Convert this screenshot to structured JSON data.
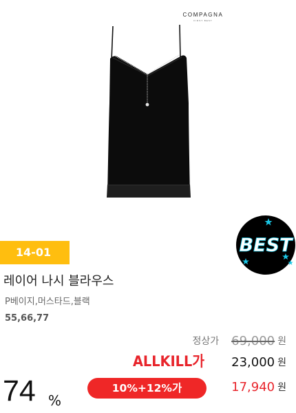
{
  "brand": {
    "name": "COMPAGNA",
    "tagline": "FIRST BEST"
  },
  "product": {
    "code": "14-01",
    "title": "레이어 나시 블라우스",
    "colors": "P베이지,머스타드,블랙",
    "sizes": "55,66,77",
    "image_icon": "black-cami-blouse-with-chain-necklace"
  },
  "badge": {
    "text": "BEST",
    "star_icon": "star-icon"
  },
  "pricing": {
    "regular_label": "정상가",
    "regular_price": "69,000",
    "allkill_logo": "ALLKILL가",
    "allkill_price": "23,000",
    "discount_label": "10%+12%가",
    "final_price": "17,940",
    "currency": "원"
  },
  "discount_rate": {
    "value": "74",
    "unit": "%"
  },
  "colors": {
    "accent_yellow": "#ffbe0f",
    "accent_red": "#ef2727",
    "price_red": "#e8242b",
    "badge_black": "#000000",
    "badge_cyan": "#19c7e6"
  }
}
